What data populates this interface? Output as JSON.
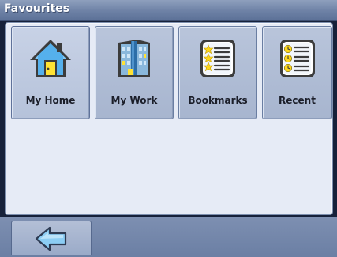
{
  "window": {
    "title": "Favourites"
  },
  "tiles": [
    {
      "label": "My Home",
      "icon": "home-icon"
    },
    {
      "label": "My Work",
      "icon": "office-building-icon"
    },
    {
      "label": "Bookmarks",
      "icon": "star-list-icon"
    },
    {
      "label": "Recent",
      "icon": "clock-list-icon"
    }
  ],
  "bottom": {
    "back_icon": "back-arrow-icon"
  },
  "colors": {
    "panel_bg": "#e6ebf6",
    "tile_bg": "#a7b5cf",
    "bar_bg": "#6b7fa4",
    "title_text": "#ffffff"
  }
}
